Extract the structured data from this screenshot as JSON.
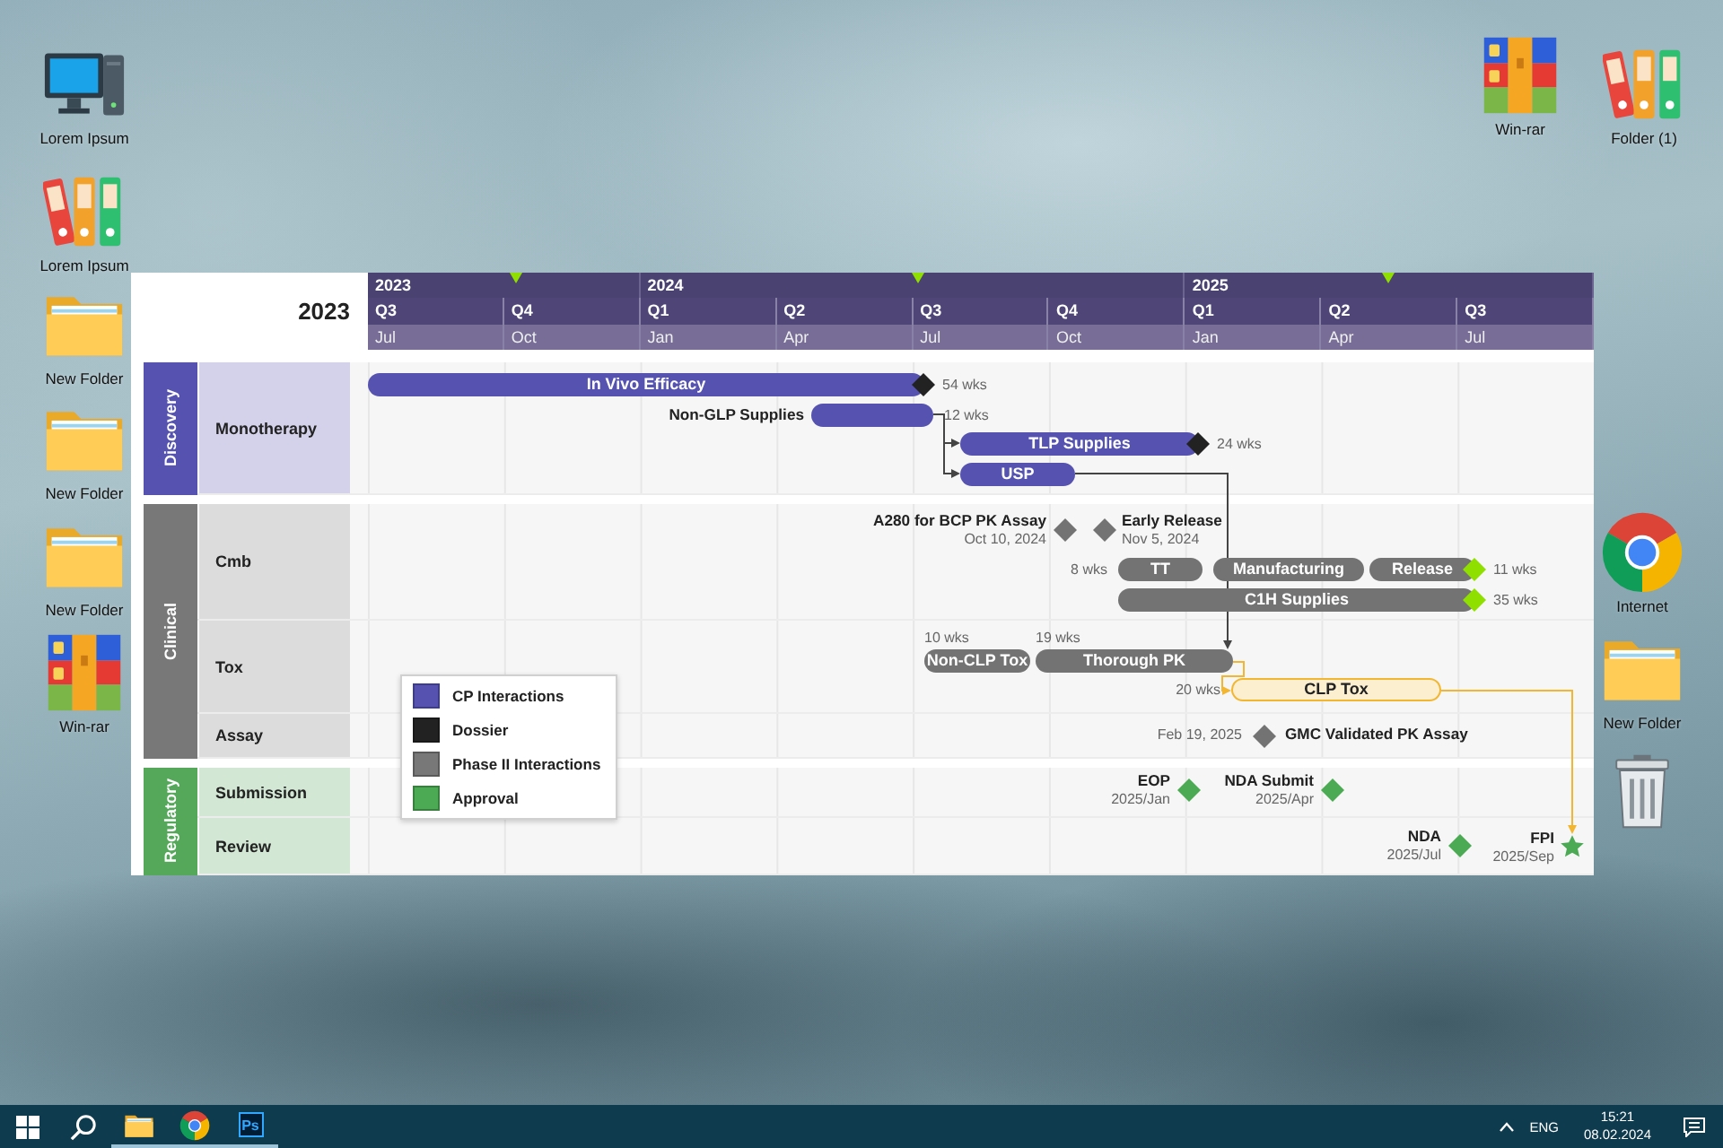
{
  "desktop_icons": [
    {
      "kind": "computer",
      "label": "Lorem Ipsum"
    },
    {
      "kind": "binders",
      "label": "Lorem Ipsum"
    },
    {
      "kind": "folder",
      "label": "New Folder"
    },
    {
      "kind": "folder",
      "label": "New Folder"
    },
    {
      "kind": "folder",
      "label": "New Folder"
    },
    {
      "kind": "archive",
      "label": "Win-rar"
    },
    {
      "kind": "archive",
      "label": "Win-rar"
    },
    {
      "kind": "binders",
      "label": "Folder (1)"
    },
    {
      "kind": "browser",
      "label": "Internet"
    },
    {
      "kind": "folder",
      "label": "New Folder"
    },
    {
      "kind": "trash"
    }
  ],
  "chart": {
    "title": "2023",
    "years": [
      {
        "label": "2023",
        "quarters": [
          {
            "label": "Q3",
            "month": "Jul"
          },
          {
            "label": "Q4",
            "month": "Oct"
          }
        ]
      },
      {
        "label": "2024",
        "quarters": [
          {
            "label": "Q1",
            "month": "Jan"
          },
          {
            "label": "Q2",
            "month": "Apr"
          },
          {
            "label": "Q3",
            "month": "Jul"
          },
          {
            "label": "Q4",
            "month": "Oct"
          }
        ]
      },
      {
        "label": "2025",
        "quarters": [
          {
            "label": "Q1",
            "month": "Jan"
          },
          {
            "label": "Q2",
            "month": "Apr"
          },
          {
            "label": "Q3",
            "month": "Jul"
          }
        ]
      }
    ],
    "groups": [
      {
        "name": "Discovery",
        "color": "#5552b0",
        "rows": [
          "Monotherapy"
        ]
      },
      {
        "name": "Clinical",
        "color": "#787878",
        "rows": [
          "Cmb",
          "Tox",
          "Assay"
        ]
      },
      {
        "name": "Regulatory",
        "color": "#55a85a",
        "rows": [
          "Submission",
          "Review"
        ]
      }
    ],
    "bars": [
      {
        "label": "In Vivo Efficacy",
        "duration": "54 wks",
        "kind": "solid",
        "color": "#5552b0",
        "end_marker": {
          "color": "#222222"
        }
      },
      {
        "label": "Non-GLP Supplies",
        "duration": "12 wks",
        "kind": "solid",
        "color": "#5552b0"
      },
      {
        "label": "TLP Supplies",
        "duration": "24 wks",
        "kind": "solid",
        "color": "#5552b0",
        "end_marker": {
          "color": "#222222"
        }
      },
      {
        "label": "USP",
        "kind": "solid",
        "color": "#5552b0"
      },
      {
        "label": "TT",
        "duration": "8 wks",
        "kind": "solid",
        "color": "#737373"
      },
      {
        "label": "Manufacturing",
        "kind": "solid",
        "color": "#737373"
      },
      {
        "label": "Release",
        "duration": "11 wks",
        "kind": "solid",
        "color": "#737373",
        "end_marker": {
          "color": "#8fe000"
        }
      },
      {
        "label": "C1H Supplies",
        "duration": "35 wks",
        "kind": "solid",
        "color": "#737373",
        "end_marker": {
          "color": "#8fe000"
        }
      },
      {
        "label": "Non-CLP Tox",
        "duration": "10 wks",
        "kind": "solid",
        "color": "#737373"
      },
      {
        "label": "Thorough PK",
        "duration": "19 wks",
        "kind": "solid",
        "color": "#737373"
      },
      {
        "label": "CLP Tox",
        "duration": "20 wks",
        "kind": "outlined",
        "color": "#fcefcf"
      }
    ],
    "milestones": [
      {
        "label": "A280 for BCP PK Assay",
        "date": "Oct 10, 2024",
        "kind": "diamond",
        "color": "#737373"
      },
      {
        "label": "Early Release",
        "date": "Nov 5, 2024",
        "kind": "diamond",
        "color": "#737373"
      },
      {
        "label": "GMC Validated PK Assay",
        "date": "Feb 19, 2025",
        "kind": "diamond",
        "color": "#737373"
      },
      {
        "label": "EOP",
        "date": "2025/Jan",
        "kind": "diamond",
        "color": "#4caa55"
      },
      {
        "label": "NDA Submit",
        "date": "2025/Apr",
        "kind": "diamond",
        "color": "#4caa55"
      },
      {
        "label": "NDA",
        "date": "2025/Jul",
        "kind": "diamond",
        "color": "#4caa55"
      },
      {
        "label": "FPI",
        "date": "2025/Sep",
        "kind": "star",
        "color": "#4caa55"
      }
    ],
    "legend": [
      {
        "label": "CP Interactions",
        "color": "#5552b0"
      },
      {
        "label": "Dossier",
        "color": "#222222"
      },
      {
        "label": "Phase II Interactions",
        "color": "#787878"
      },
      {
        "label": "Approval",
        "color": "#4caa55"
      }
    ]
  },
  "taskbar": {
    "apps": [
      {
        "kind": "start",
        "running": false
      },
      {
        "kind": "search",
        "running": false
      },
      {
        "kind": "files",
        "running": true
      },
      {
        "kind": "browser",
        "running": true
      },
      {
        "kind": "photoshop",
        "text": "Ps",
        "running": true
      }
    ],
    "language": "ENG",
    "time": "15:21",
    "date": "08.02.2024"
  }
}
